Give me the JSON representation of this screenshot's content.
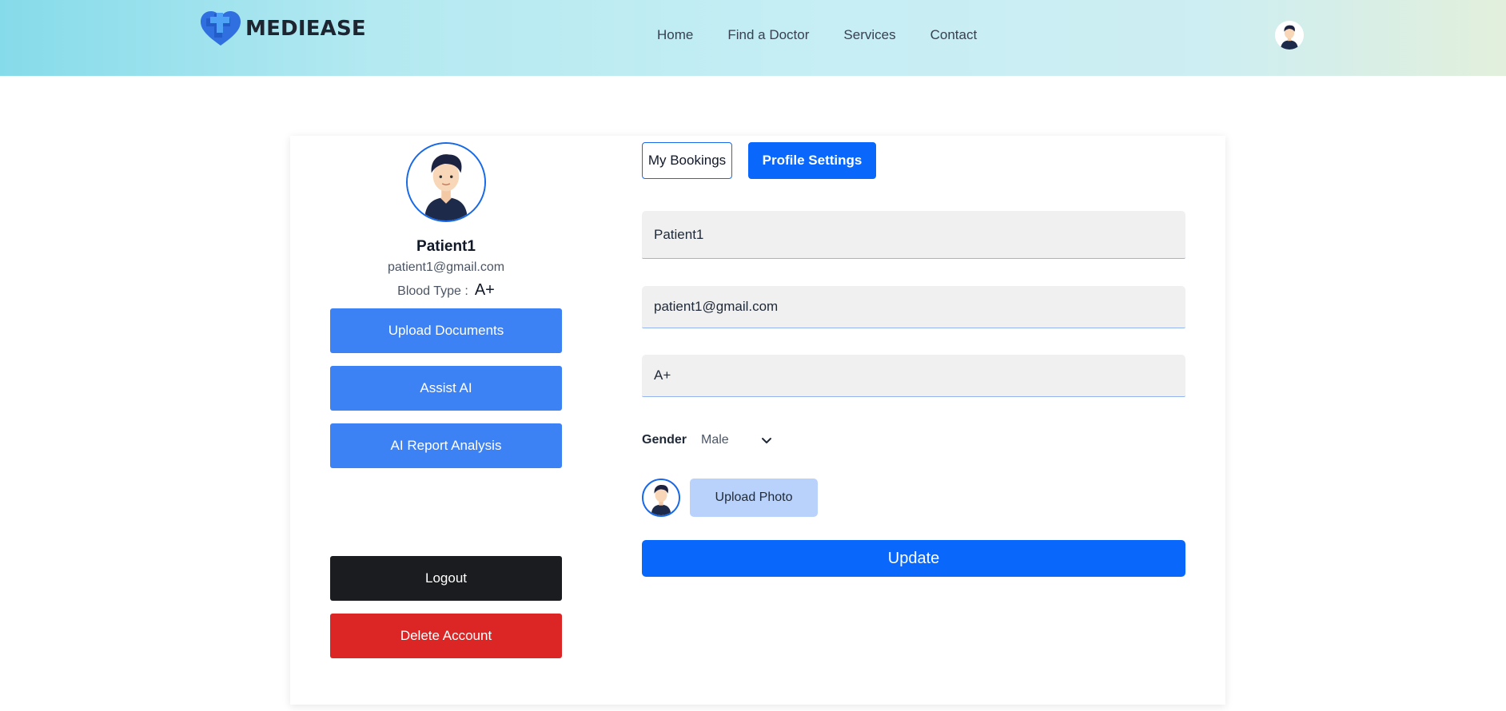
{
  "brand": {
    "name": "MEDIEASE",
    "accent": "#1769e8"
  },
  "nav": {
    "items": [
      "Home",
      "Find a Doctor",
      "Services",
      "Contact"
    ]
  },
  "profile": {
    "name": "Patient1",
    "email": "patient1@gmail.com",
    "blood_label": "Blood Type :",
    "blood_value": "A+"
  },
  "sidebar": {
    "upload_documents": "Upload Documents",
    "assist_ai": "Assist AI",
    "ai_report_analysis": "AI Report Analysis",
    "logout": "Logout",
    "delete_account": "Delete Account"
  },
  "tabs": {
    "bookings": "My Bookings",
    "settings": "Profile Settings"
  },
  "form": {
    "name_value": "Patient1",
    "email_value": "patient1@gmail.com",
    "blood_value": "A+",
    "gender_label": "Gender",
    "gender_value": "Male",
    "upload_photo": "Upload Photo",
    "update": "Update"
  },
  "icons": {
    "avatar": "user-avatar-icon",
    "chevron": "chevron-down-icon",
    "logo": "heart-cross-logo-icon"
  }
}
